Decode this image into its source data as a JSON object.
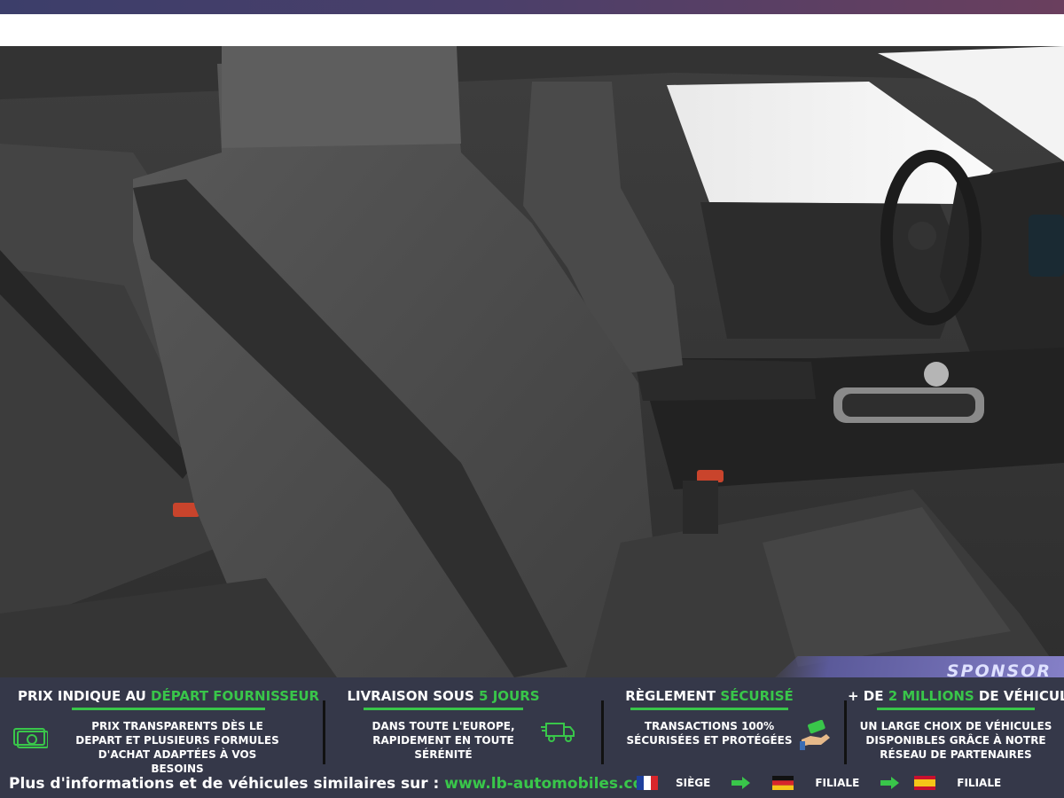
{
  "banner": {
    "sponsor_label": "SPONSOR"
  },
  "photo": {
    "subject": "car-interior-front-seats",
    "colors": {
      "seat": "#4a4a4a",
      "dark": "#2a2a2a",
      "window": "#f2f2f2"
    }
  },
  "features": [
    {
      "title_prefix": "PRIX INDIQUE AU ",
      "title_highlight": "DÉPART FOURNISSEUR",
      "title_suffix": "",
      "description": "PRIX TRANSPARENTS DÈS LE DEPART ET PLUSIEURS FORMULES D'ACHAT ADAPTÉES À VOS BESOINS",
      "icon": "money-icon"
    },
    {
      "title_prefix": "LIVRAISON SOUS ",
      "title_highlight": "5 JOURS",
      "title_suffix": "",
      "description": "DANS TOUTE L'EUROPE, RAPIDEMENT EN TOUTE SÉRÉNITÉ",
      "icon": "delivery-truck-icon"
    },
    {
      "title_prefix": "RÈGLEMENT ",
      "title_highlight": "SÉCURISÉ",
      "title_suffix": "",
      "description": "TRANSACTIONS 100% SÉCURISÉES ET PROTÉGÉES",
      "icon": "payment-hand-icon"
    },
    {
      "title_prefix": "+ DE ",
      "title_highlight": "2 MILLIONS",
      "title_suffix": " DE VÉHICULES",
      "description": "UN LARGE CHOIX DE VÉHICULES DISPONIBLES GRÂCE À NOTRE RÉSEAU DE PARTENAIRES",
      "icon": ""
    }
  ],
  "footer": {
    "info_text": "Plus d'informations et de véhicules similaires sur : ",
    "url": "www.lb-automobiles.com",
    "chain": [
      {
        "flag": "france-flag-icon",
        "label": "SIÈGE"
      },
      {
        "flag": "germany-flag-icon",
        "label": "FILIALE"
      },
      {
        "flag": "spain-flag-icon",
        "label": "FILIALE"
      }
    ]
  },
  "colors": {
    "accent": "#39c64a",
    "footer_bg": "#353849",
    "sponsor": "#6e6bb0"
  }
}
